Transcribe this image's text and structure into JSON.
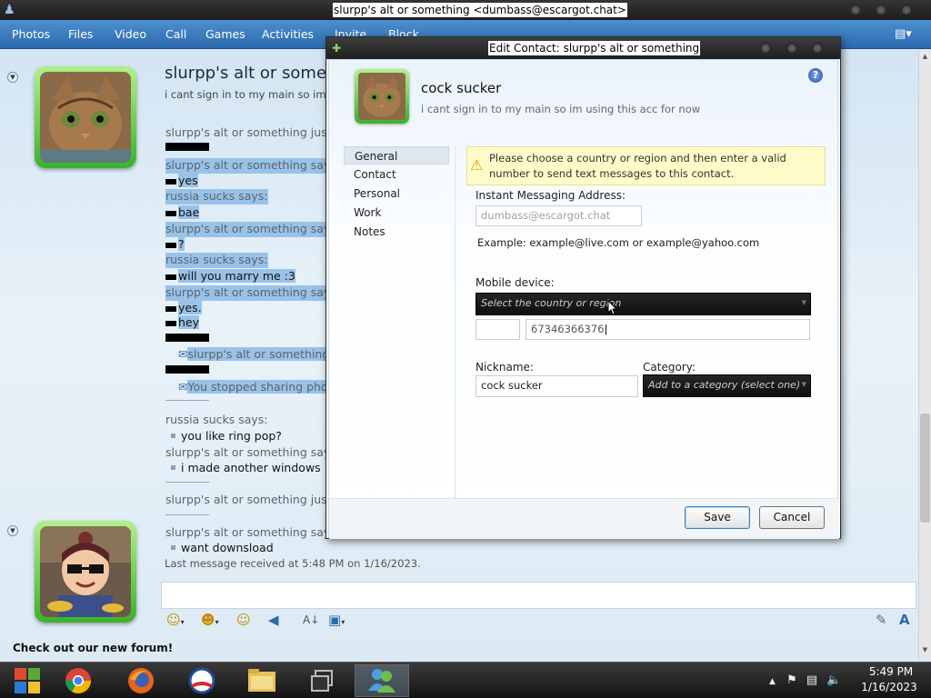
{
  "window": {
    "title": "slurpp's alt or something <dumbass@escargot.chat>"
  },
  "menu": {
    "items": [
      "Photos",
      "Files",
      "Video",
      "Call",
      "Games",
      "Activities",
      "Invite",
      "Block"
    ]
  },
  "chat": {
    "contact_name": "slurpp's alt or something",
    "contact_status": "i cant sign in to my main so im using this acc for now",
    "lines": [
      {
        "sender": "slurpp's alt or something just"
      },
      {
        "sender": "slurpp's alt or something says:"
      },
      {
        "text": "yes"
      },
      {
        "sender": "russia sucks says:"
      },
      {
        "text": "bae"
      },
      {
        "sender": "slurpp's alt or something says:"
      },
      {
        "text": "?"
      },
      {
        "sender": "russia sucks says:"
      },
      {
        "text": "will you marry me :3"
      },
      {
        "sender": "slurpp's alt or something says:"
      },
      {
        "text": "yes."
      },
      {
        "text": "hey"
      },
      {
        "text": "slurpp's alt or something"
      },
      {
        "text": "You stopped sharing photos"
      },
      {
        "sender": "russia sucks says:"
      },
      {
        "text": "you like ring pop?"
      },
      {
        "sender": "slurpp's alt or something says:"
      },
      {
        "text": "i made another windows"
      },
      {
        "sender": "slurpp's alt or something just"
      },
      {
        "sender": "slurpp's alt or something says:"
      },
      {
        "text": "want downsload"
      }
    ],
    "last_received": "Last message received at 5:48 PM on 1/16/2023.",
    "forum_link": "Check out our new forum!"
  },
  "dialog": {
    "title": "Edit Contact: slurpp's alt or something",
    "contact_name": "cock sucker",
    "contact_status": "i cant sign in to my main so im using this acc for now",
    "nav": [
      "General",
      "Contact",
      "Personal",
      "Work",
      "Notes"
    ],
    "warning": "Please choose a country or region and then enter a valid number to send text messages to this contact.",
    "im_label": "Instant Messaging Address:",
    "im_value": "dumbass@escargot.chat",
    "example": "Example: example@live.com or example@yahoo.com",
    "mobile_label": "Mobile device:",
    "country_placeholder": "Select the country or region",
    "phone_value": "67346366376",
    "nickname_label": "Nickname:",
    "nickname_value": "cock sucker",
    "category_label": "Category:",
    "category_placeholder": "Add to a category (select one)",
    "save": "Save",
    "cancel": "Cancel"
  },
  "taskbar": {
    "time": "5:49 PM",
    "date": "1/16/2023"
  }
}
